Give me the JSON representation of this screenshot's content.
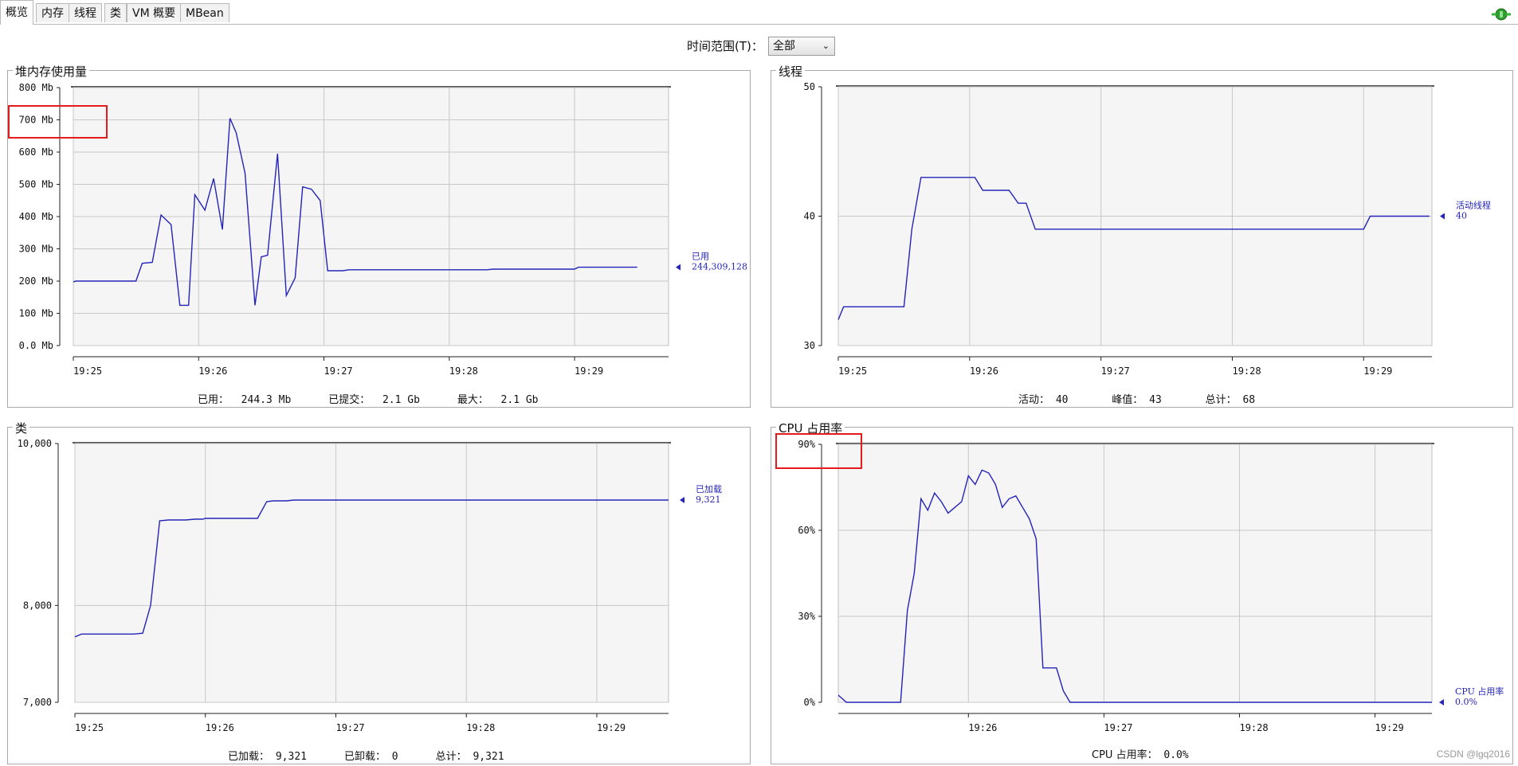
{
  "tabs": [
    {
      "label": "概览",
      "active": true
    },
    {
      "label": "内存",
      "active": false
    },
    {
      "label": "线程",
      "active": false
    },
    {
      "label": "类",
      "active": false
    },
    {
      "label": "VM 概要",
      "active": false
    },
    {
      "label": "MBean",
      "active": false
    }
  ],
  "connection_icon": "connected-plug-icon",
  "time_range": {
    "label": "时间范围(T)：",
    "value": "全部"
  },
  "watermark": "CSDN @lgq2016",
  "colors": {
    "series": "#2424b8",
    "grid": "#c8c8c8",
    "plot_bg": "#f5f5f5",
    "highlight": "#e51b1b"
  },
  "panels": {
    "heap": {
      "title": "堆内存使用量",
      "legend": {
        "name": "已用",
        "value": "244,309,128"
      },
      "summary": {
        "used_label": "已用：",
        "used_value": "244.3 Mb",
        "committed_label": "已提交：",
        "committed_value": "2.1 Gb",
        "max_label": "最大：",
        "max_value": "2.1 Gb"
      }
    },
    "threads": {
      "title": "线程",
      "legend": {
        "name": "活动线程",
        "value": "40"
      },
      "summary": {
        "live_label": "活动：",
        "live_value": "40",
        "peak_label": "峰值：",
        "peak_value": "43",
        "total_label": "总计：",
        "total_value": "68"
      }
    },
    "classes": {
      "title": "类",
      "legend": {
        "name": "已加载",
        "value": "9,321"
      },
      "summary": {
        "loaded_label": "已加载：",
        "loaded_value": "9,321",
        "unloaded_label": "已卸载：",
        "unloaded_value": "0",
        "total_label": "总计：",
        "total_value": "9,321"
      }
    },
    "cpu": {
      "title": "CPU 占用率",
      "legend": {
        "name": "CPU 占用率",
        "value": "0.0%"
      },
      "summary": {
        "label": "CPU 占用率：",
        "value": "0.0%"
      }
    }
  },
  "chart_data": [
    {
      "id": "heap",
      "type": "line",
      "title": "堆内存使用量",
      "y_unit": "Mb",
      "xlim": [
        0.0,
        4.75
      ],
      "ylim": [
        0,
        800
      ],
      "x_ticks": [
        {
          "v": 0,
          "label": "19:25"
        },
        {
          "v": 1,
          "label": "19:26"
        },
        {
          "v": 2,
          "label": "19:27"
        },
        {
          "v": 3,
          "label": "19:28"
        },
        {
          "v": 4,
          "label": "19:29"
        }
      ],
      "y_ticks": [
        {
          "v": 0,
          "label": "0.0 Mb"
        },
        {
          "v": 100,
          "label": "100 Mb"
        },
        {
          "v": 200,
          "label": "200 Mb"
        },
        {
          "v": 300,
          "label": "300 Mb"
        },
        {
          "v": 400,
          "label": "400 Mb"
        },
        {
          "v": 500,
          "label": "500 Mb"
        },
        {
          "v": 600,
          "label": "600 Mb"
        },
        {
          "v": 700,
          "label": "700 Mb"
        },
        {
          "v": 800,
          "label": "800 Mb"
        }
      ],
      "series": [
        {
          "name": "已用",
          "points": [
            [
              0.0,
              197
            ],
            [
              0.02,
              200
            ],
            [
              0.5,
              200
            ],
            [
              0.55,
              255
            ],
            [
              0.63,
              258
            ],
            [
              0.7,
              405
            ],
            [
              0.78,
              375
            ],
            [
              0.85,
              125
            ],
            [
              0.92,
              125
            ],
            [
              0.97,
              468
            ],
            [
              1.05,
              420
            ],
            [
              1.12,
              518
            ],
            [
              1.19,
              360
            ],
            [
              1.25,
              705
            ],
            [
              1.3,
              660
            ],
            [
              1.37,
              535
            ],
            [
              1.45,
              125
            ],
            [
              1.5,
              275
            ],
            [
              1.55,
              280
            ],
            [
              1.63,
              595
            ],
            [
              1.7,
              155
            ],
            [
              1.77,
              210
            ],
            [
              1.83,
              492
            ],
            [
              1.9,
              485
            ],
            [
              1.97,
              450
            ],
            [
              2.03,
              232
            ],
            [
              2.15,
              232
            ],
            [
              2.2,
              235
            ],
            [
              3.3,
              235
            ],
            [
              3.35,
              237
            ],
            [
              4.0,
              237
            ],
            [
              4.03,
              243
            ],
            [
              4.5,
              243
            ]
          ]
        }
      ]
    },
    {
      "id": "threads",
      "type": "line",
      "title": "线程",
      "xlim": [
        0.0,
        4.52
      ],
      "ylim": [
        30,
        50
      ],
      "x_ticks": [
        {
          "v": 0,
          "label": "19:25"
        },
        {
          "v": 1,
          "label": "19:26"
        },
        {
          "v": 2,
          "label": "19:27"
        },
        {
          "v": 3,
          "label": "19:28"
        },
        {
          "v": 4,
          "label": "19:29"
        }
      ],
      "y_ticks": [
        {
          "v": 30,
          "label": "30"
        },
        {
          "v": 40,
          "label": "40"
        },
        {
          "v": 50,
          "label": "50"
        }
      ],
      "series": [
        {
          "name": "活动线程",
          "points": [
            [
              0.0,
              32
            ],
            [
              0.04,
              33
            ],
            [
              0.5,
              33
            ],
            [
              0.56,
              39
            ],
            [
              0.63,
              43
            ],
            [
              1.04,
              43
            ],
            [
              1.1,
              42
            ],
            [
              1.3,
              42
            ],
            [
              1.37,
              41
            ],
            [
              1.43,
              41
            ],
            [
              1.5,
              39
            ],
            [
              4.0,
              39
            ],
            [
              4.05,
              40
            ],
            [
              4.5,
              40
            ]
          ]
        }
      ]
    },
    {
      "id": "classes",
      "type": "line",
      "title": "类",
      "xlim": [
        0.0,
        4.55
      ],
      "ylim": [
        7000,
        10000
      ],
      "x_ticks": [
        {
          "v": 0,
          "label": "19:25"
        },
        {
          "v": 1,
          "label": "19:26"
        },
        {
          "v": 2,
          "label": "19:27"
        },
        {
          "v": 3,
          "label": "19:28"
        },
        {
          "v": 4,
          "label": "19:29"
        }
      ],
      "y_ticks": [
        {
          "v": 7000,
          "label": "7,000"
        },
        {
          "v": 8000,
          "label": "8,000"
        },
        {
          "v": 10000,
          "label": "10,000"
        }
      ],
      "series": [
        {
          "name": "已加载",
          "points": [
            [
              0.0,
              7660
            ],
            [
              0.05,
              7690
            ],
            [
              0.1,
              7690
            ],
            [
              0.45,
              7690
            ],
            [
              0.52,
              7700
            ],
            [
              0.58,
              8000
            ],
            [
              0.65,
              8990
            ],
            [
              0.72,
              9000
            ],
            [
              0.85,
              9000
            ],
            [
              0.92,
              9010
            ],
            [
              0.98,
              9010
            ],
            [
              1.0,
              9020
            ],
            [
              1.04,
              9020
            ],
            [
              1.4,
              9020
            ],
            [
              1.47,
              9230
            ],
            [
              1.52,
              9240
            ],
            [
              1.62,
              9240
            ],
            [
              1.68,
              9250
            ],
            [
              4.55,
              9250
            ]
          ]
        }
      ]
    },
    {
      "id": "cpu",
      "type": "line",
      "title": "CPU 占用率",
      "xlim": [
        -0.96,
        3.42
      ],
      "ylim": [
        0,
        90
      ],
      "x_ticks": [
        {
          "v": 0,
          "label": "19:26"
        },
        {
          "v": 1,
          "label": "19:27"
        },
        {
          "v": 2,
          "label": "19:28"
        },
        {
          "v": 3,
          "label": "19:29"
        }
      ],
      "y_ticks": [
        {
          "v": 0,
          "label": "0%"
        },
        {
          "v": 30,
          "label": "30%"
        },
        {
          "v": 60,
          "label": "60%"
        },
        {
          "v": 90,
          "label": "90%"
        }
      ],
      "series": [
        {
          "name": "CPU 占用率",
          "points": [
            [
              -0.96,
              2.5
            ],
            [
              -0.9,
              0
            ],
            [
              -0.5,
              0
            ],
            [
              -0.45,
              32
            ],
            [
              -0.4,
              45
            ],
            [
              -0.35,
              71
            ],
            [
              -0.3,
              67
            ],
            [
              -0.25,
              73
            ],
            [
              -0.2,
              70
            ],
            [
              -0.15,
              66
            ],
            [
              -0.1,
              68
            ],
            [
              -0.05,
              70
            ],
            [
              0.0,
              79
            ],
            [
              0.05,
              76
            ],
            [
              0.1,
              81
            ],
            [
              0.15,
              80
            ],
            [
              0.2,
              76
            ],
            [
              0.25,
              68
            ],
            [
              0.3,
              71
            ],
            [
              0.35,
              72
            ],
            [
              0.4,
              68
            ],
            [
              0.45,
              64
            ],
            [
              0.5,
              57
            ],
            [
              0.55,
              12
            ],
            [
              0.6,
              12
            ],
            [
              0.65,
              12
            ],
            [
              0.7,
              4
            ],
            [
              0.75,
              0
            ],
            [
              3.42,
              0
            ]
          ]
        }
      ]
    }
  ]
}
